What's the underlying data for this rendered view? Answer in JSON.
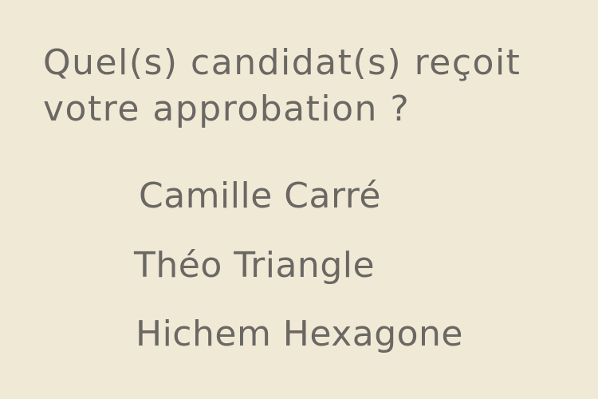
{
  "question": {
    "line1": "Quel(s) candidat(s) reçoit",
    "line2": "votre approbation ?"
  },
  "options": [
    {
      "label": "Camille Carré"
    },
    {
      "label": "Théo Triangle"
    },
    {
      "label": "Hichem Hexagone"
    }
  ],
  "colors": {
    "background": "#f0e9d6",
    "text": "#6b6763"
  }
}
